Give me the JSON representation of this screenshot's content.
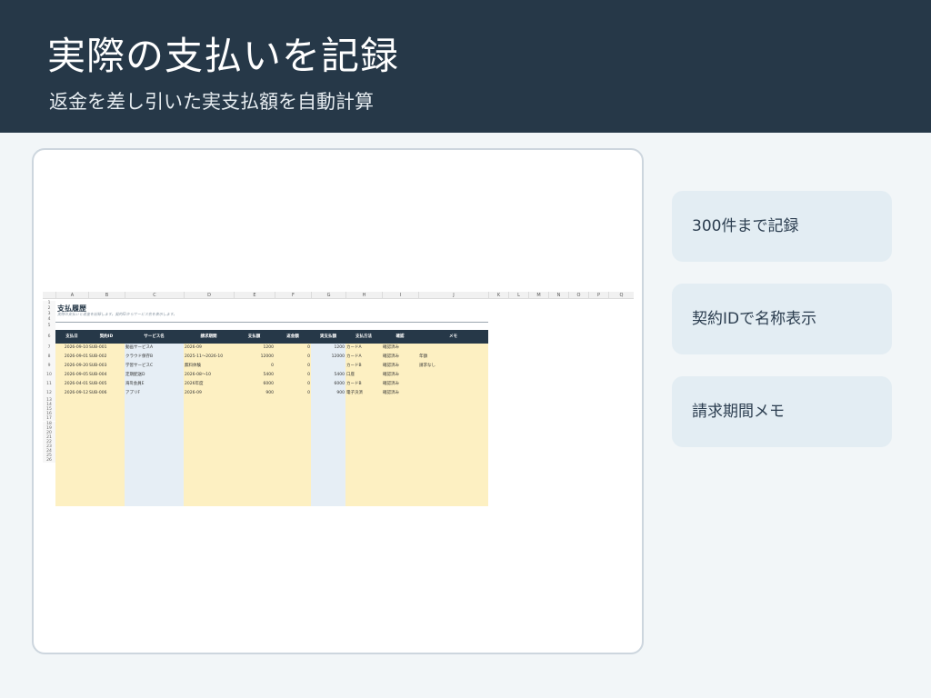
{
  "header": {
    "title": "実際の支払いを記録",
    "subtitle": "返金を差し引いた実支払額を自動計算"
  },
  "sheet": {
    "columns": [
      "A",
      "B",
      "C",
      "D",
      "E",
      "F",
      "G",
      "H",
      "I",
      "J",
      "K",
      "L",
      "M",
      "N",
      "O",
      "P",
      "Q"
    ],
    "row_numbers": [
      "1",
      "2",
      "3",
      "4",
      "5",
      "6",
      "7",
      "8",
      "9",
      "10",
      "11",
      "12",
      "13",
      "14",
      "15",
      "16",
      "17",
      "18",
      "19",
      "20",
      "21",
      "22",
      "23",
      "24",
      "25",
      "26"
    ],
    "title": "支払履歴",
    "subtitle": "実際の支払いと返金を記録します。契約IDからサービス名を表示します。",
    "headers": [
      "支払日",
      "契約ID",
      "サービス名",
      "請求期間",
      "支払額",
      "返金額",
      "実支払額",
      "支払方法",
      "確認",
      "メモ"
    ],
    "rows": [
      [
        "2026-09-10",
        "SUB-001",
        "動画サービスA",
        "2026-09",
        "1200",
        "0",
        "1200",
        "カードA",
        "確認済み",
        ""
      ],
      [
        "2026-09-01",
        "SUB-002",
        "クラウド保存B",
        "2025-11～2026-10",
        "12000",
        "0",
        "12000",
        "カードA",
        "確認済み",
        "年額"
      ],
      [
        "2026-09-20",
        "SUB-003",
        "学習サービスC",
        "無料体験",
        "0",
        "0",
        "",
        "カードB",
        "確認済み",
        "請求なし"
      ],
      [
        "2026-09-05",
        "SUB-004",
        "定期配送D",
        "2026-08～10",
        "5400",
        "0",
        "5400",
        "口座",
        "確認済み",
        ""
      ],
      [
        "2026-04-01",
        "SUB-005",
        "海외会員E",
        "2026年度",
        "6000",
        "0",
        "6000",
        "カードB",
        "確認済み",
        ""
      ],
      [
        "2026-09-12",
        "SUB-006",
        "アプリF",
        "2026-09",
        "900",
        "0",
        "900",
        "電子決済",
        "確認済み",
        ""
      ]
    ]
  },
  "features": [
    {
      "label": "300件まで記録"
    },
    {
      "label": "契約IDで名称表示"
    },
    {
      "label": "請求期間メモ"
    }
  ],
  "colors": {
    "header_bg": "#263848",
    "input_band": "#fdf0c2",
    "formula_band": "#e6eef5"
  }
}
